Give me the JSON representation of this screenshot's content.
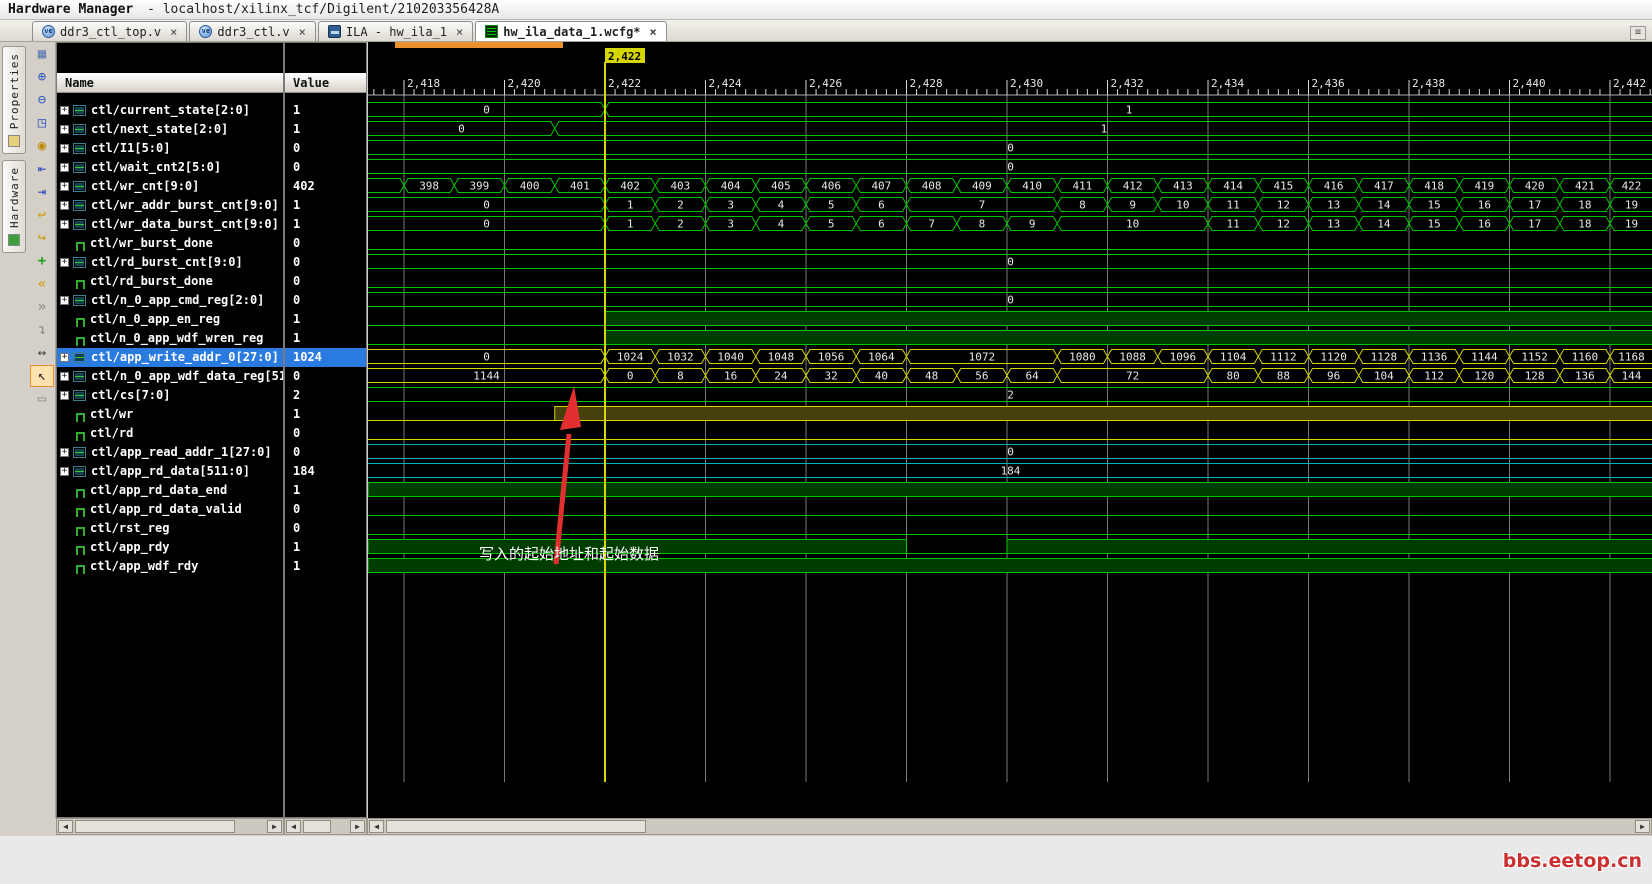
{
  "title_bar": {
    "app_name": "Hardware Manager",
    "session": "- localhost/xilinx_tcf/Digilent/210203356428A"
  },
  "tabs": [
    {
      "label": "ddr3_ctl_top.v",
      "icon": "verilog-file-icon",
      "close": "×",
      "active": false
    },
    {
      "label": "ddr3_ctl.v",
      "icon": "verilog-file-icon",
      "close": "×",
      "active": false
    },
    {
      "label": "ILA - hw_ila_1",
      "icon": "ila-icon",
      "close": "×",
      "active": false
    },
    {
      "label": "hw_ila_data_1.wcfg*",
      "icon": "waveform-icon",
      "close": "×",
      "active": true
    }
  ],
  "side_tabs": [
    {
      "label": "Properties",
      "icon": "properties-icon"
    },
    {
      "label": "Hardware",
      "icon": "hardware-icon"
    }
  ],
  "toolbar_icons": [
    {
      "name": "save-waveform-icon",
      "active": false
    },
    {
      "name": "zoom-in-icon",
      "active": false
    },
    {
      "name": "zoom-out-icon",
      "active": false
    },
    {
      "name": "zoom-fit-icon",
      "active": false
    },
    {
      "name": "zoom-range-icon",
      "active": false
    },
    {
      "name": "go-to-start-icon",
      "active": false
    },
    {
      "name": "go-to-end-icon",
      "active": false
    },
    {
      "name": "previous-transition-icon",
      "active": false
    },
    {
      "name": "next-transition-icon",
      "active": false
    },
    {
      "name": "add-signal-icon",
      "active": false
    },
    {
      "name": "insert-before-icon",
      "active": false
    },
    {
      "name": "insert-after-icon",
      "active": false
    },
    {
      "name": "collapse-icon",
      "active": false
    },
    {
      "name": "measure-icon",
      "active": false
    },
    {
      "name": "select-pointer-icon",
      "active": true
    },
    {
      "name": "snap-mode-icon",
      "active": false
    }
  ],
  "table": {
    "name_header": "Name",
    "value_header": "Value"
  },
  "waveform": {
    "axis": {
      "tick_labels": [
        "2,418",
        "2,420",
        "2,422",
        "2,424",
        "2,426",
        "2,428",
        "2,430",
        "2,432",
        "2,434",
        "2,436",
        "2,438",
        "2,440",
        "2,442"
      ],
      "t_start": 2418,
      "t_step": 2,
      "minor_per_major": 10
    },
    "cursor": {
      "time": 2422,
      "label": "2,422"
    },
    "annotation": {
      "text": "写入的起始地址和起始数据"
    },
    "colors": {
      "wave_green": "#00c400",
      "wave_yellow": "#d4d400",
      "wave_cyan": "#00b4b4",
      "fill_green": "#003c00",
      "fill_yellow": "#45400a",
      "fill_cyan": "#003c3c",
      "cursor": "#d6d600",
      "grid": "#787878",
      "annotation": "#e23030",
      "selection": "#2a7be0",
      "active_tab_bar": "#e8912d"
    },
    "signals": [
      {
        "name": "ctl/current_state[2:0]",
        "value": "1",
        "kind": "bus",
        "color": "green",
        "selected": false,
        "segs": [
          [
            "0",
            2417,
            2422
          ],
          [
            "1",
            2422,
            2443
          ]
        ]
      },
      {
        "name": "ctl/next_state[2:0]",
        "value": "1",
        "kind": "bus",
        "color": "green",
        "selected": false,
        "segs": [
          [
            "0",
            2417,
            2421
          ],
          [
            "1",
            2421,
            2443
          ]
        ]
      },
      {
        "name": "ctl/I1[5:0]",
        "value": "0",
        "kind": "bus",
        "color": "green",
        "selected": false,
        "segs": [
          [
            "0",
            2417,
            2443
          ]
        ]
      },
      {
        "name": "ctl/wait_cnt2[5:0]",
        "value": "0",
        "kind": "bus",
        "color": "green",
        "selected": false,
        "segs": [
          [
            "0",
            2417,
            2443
          ]
        ]
      },
      {
        "name": "ctl/wr_cnt[9:0]",
        "value": "402",
        "kind": "bus",
        "color": "green",
        "selected": false,
        "segs": [
          [
            "",
            2417,
            2418
          ],
          [
            "398",
            2418,
            2419
          ],
          [
            "399",
            2419,
            2420
          ],
          [
            "400",
            2420,
            2421
          ],
          [
            "401",
            2421,
            2422
          ],
          [
            "402",
            2422,
            2423
          ],
          [
            "403",
            2423,
            2424
          ],
          [
            "404",
            2424,
            2425
          ],
          [
            "405",
            2425,
            2426
          ],
          [
            "406",
            2426,
            2427
          ],
          [
            "407",
            2427,
            2428
          ],
          [
            "408",
            2428,
            2429
          ],
          [
            "409",
            2429,
            2430
          ],
          [
            "410",
            2430,
            2431
          ],
          [
            "411",
            2431,
            2432
          ],
          [
            "412",
            2432,
            2433
          ],
          [
            "413",
            2433,
            2434
          ],
          [
            "414",
            2434,
            2435
          ],
          [
            "415",
            2435,
            2436
          ],
          [
            "416",
            2436,
            2437
          ],
          [
            "417",
            2437,
            2438
          ],
          [
            "418",
            2438,
            2439
          ],
          [
            "419",
            2439,
            2440
          ],
          [
            "420",
            2440,
            2441
          ],
          [
            "421",
            2441,
            2442
          ],
          [
            "422",
            2442,
            2443
          ]
        ]
      },
      {
        "name": "ctl/wr_addr_burst_cnt[9:0]",
        "value": "1",
        "kind": "bus",
        "color": "green",
        "selected": false,
        "segs": [
          [
            "0",
            2417,
            2422
          ],
          [
            "1",
            2422,
            2423
          ],
          [
            "2",
            2423,
            2424
          ],
          [
            "3",
            2424,
            2425
          ],
          [
            "4",
            2425,
            2426
          ],
          [
            "5",
            2426,
            2427
          ],
          [
            "6",
            2427,
            2428
          ],
          [
            "7",
            2428,
            2431
          ],
          [
            "8",
            2431,
            2432
          ],
          [
            "9",
            2432,
            2433
          ],
          [
            "10",
            2433,
            2434
          ],
          [
            "11",
            2434,
            2435
          ],
          [
            "12",
            2435,
            2436
          ],
          [
            "13",
            2436,
            2437
          ],
          [
            "14",
            2437,
            2438
          ],
          [
            "15",
            2438,
            2439
          ],
          [
            "16",
            2439,
            2440
          ],
          [
            "17",
            2440,
            2441
          ],
          [
            "18",
            2441,
            2442
          ],
          [
            "19",
            2442,
            2443
          ]
        ]
      },
      {
        "name": "ctl/wr_data_burst_cnt[9:0]",
        "value": "1",
        "kind": "bus",
        "color": "green",
        "selected": false,
        "segs": [
          [
            "0",
            2417,
            2422
          ],
          [
            "1",
            2422,
            2423
          ],
          [
            "2",
            2423,
            2424
          ],
          [
            "3",
            2424,
            2425
          ],
          [
            "4",
            2425,
            2426
          ],
          [
            "5",
            2426,
            2427
          ],
          [
            "6",
            2427,
            2428
          ],
          [
            "7",
            2428,
            2429
          ],
          [
            "8",
            2429,
            2430
          ],
          [
            "9",
            2430,
            2431
          ],
          [
            "10",
            2431,
            2434
          ],
          [
            "11",
            2434,
            2435
          ],
          [
            "12",
            2435,
            2436
          ],
          [
            "13",
            2436,
            2437
          ],
          [
            "14",
            2437,
            2438
          ],
          [
            "15",
            2438,
            2439
          ],
          [
            "16",
            2439,
            2440
          ],
          [
            "17",
            2440,
            2441
          ],
          [
            "18",
            2441,
            2442
          ],
          [
            "19",
            2442,
            2443
          ]
        ]
      },
      {
        "name": "ctl/wr_burst_done",
        "value": "0",
        "kind": "bit",
        "color": "green",
        "selected": false,
        "segs": [
          [
            0,
            2417,
            2443
          ]
        ]
      },
      {
        "name": "ctl/rd_burst_cnt[9:0]",
        "value": "0",
        "kind": "bus",
        "color": "green",
        "selected": false,
        "segs": [
          [
            "0",
            2417,
            2443
          ]
        ]
      },
      {
        "name": "ctl/rd_burst_done",
        "value": "0",
        "kind": "bit",
        "color": "green",
        "selected": false,
        "segs": [
          [
            0,
            2417,
            2443
          ]
        ]
      },
      {
        "name": "ctl/n_0_app_cmd_reg[2:0]",
        "value": "0",
        "kind": "bus",
        "color": "green",
        "selected": false,
        "segs": [
          [
            "0",
            2417,
            2443
          ]
        ]
      },
      {
        "name": "ctl/n_0_app_en_reg",
        "value": "1",
        "kind": "bit",
        "color": "green",
        "selected": false,
        "segs": [
          [
            0,
            2417,
            2422
          ],
          [
            1,
            2422,
            2443
          ]
        ]
      },
      {
        "name": "ctl/n_0_app_wdf_wren_reg",
        "value": "1",
        "kind": "bit",
        "color": "green",
        "selected": false,
        "segs": [
          [
            0,
            2417,
            2422
          ],
          [
            1,
            2422,
            2443
          ]
        ]
      },
      {
        "name": "ctl/app_write_addr_0[27:0]",
        "value": "1024",
        "kind": "bus",
        "color": "yellow",
        "selected": true,
        "segs": [
          [
            "0",
            2417,
            2422
          ],
          [
            "1024",
            2422,
            2423
          ],
          [
            "1032",
            2423,
            2424
          ],
          [
            "1040",
            2424,
            2425
          ],
          [
            "1048",
            2425,
            2426
          ],
          [
            "1056",
            2426,
            2427
          ],
          [
            "1064",
            2427,
            2428
          ],
          [
            "1072",
            2428,
            2431
          ],
          [
            "1080",
            2431,
            2432
          ],
          [
            "1088",
            2432,
            2433
          ],
          [
            "1096",
            2433,
            2434
          ],
          [
            "1104",
            2434,
            2435
          ],
          [
            "1112",
            2435,
            2436
          ],
          [
            "1120",
            2436,
            2437
          ],
          [
            "1128",
            2437,
            2438
          ],
          [
            "1136",
            2438,
            2439
          ],
          [
            "1144",
            2439,
            2440
          ],
          [
            "1152",
            2440,
            2441
          ],
          [
            "1160",
            2441,
            2442
          ],
          [
            "1168",
            2442,
            2443
          ]
        ]
      },
      {
        "name": "ctl/n_0_app_wdf_data_reg[511:0]",
        "value": "0",
        "kind": "bus",
        "color": "yellow",
        "selected": false,
        "segs": [
          [
            "1144",
            2417,
            2422
          ],
          [
            "0",
            2422,
            2423
          ],
          [
            "8",
            2423,
            2424
          ],
          [
            "16",
            2424,
            2425
          ],
          [
            "24",
            2425,
            2426
          ],
          [
            "32",
            2426,
            2427
          ],
          [
            "40",
            2427,
            2428
          ],
          [
            "48",
            2428,
            2429
          ],
          [
            "56",
            2429,
            2430
          ],
          [
            "64",
            2430,
            2431
          ],
          [
            "72",
            2431,
            2434
          ],
          [
            "80",
            2434,
            2435
          ],
          [
            "88",
            2435,
            2436
          ],
          [
            "96",
            2436,
            2437
          ],
          [
            "104",
            2437,
            2438
          ],
          [
            "112",
            2438,
            2439
          ],
          [
            "120",
            2439,
            2440
          ],
          [
            "128",
            2440,
            2441
          ],
          [
            "136",
            2441,
            2442
          ],
          [
            "144",
            2442,
            2443
          ]
        ]
      },
      {
        "name": "ctl/cs[7:0]",
        "value": "2",
        "kind": "bus",
        "color": "green",
        "selected": false,
        "segs": [
          [
            "2",
            2417,
            2443
          ]
        ]
      },
      {
        "name": "ctl/wr",
        "value": "1",
        "kind": "bit",
        "color": "yellow",
        "selected": false,
        "segs": [
          [
            0,
            2417,
            2421
          ],
          [
            1,
            2421,
            2443
          ]
        ]
      },
      {
        "name": "ctl/rd",
        "value": "0",
        "kind": "bit",
        "color": "yellow",
        "selected": false,
        "segs": [
          [
            0,
            2417,
            2443
          ]
        ]
      },
      {
        "name": "ctl/app_read_addr_1[27:0]",
        "value": "0",
        "kind": "bus",
        "color": "cyan",
        "selected": false,
        "segs": [
          [
            "0",
            2417,
            2443
          ]
        ]
      },
      {
        "name": "ctl/app_rd_data[511:0]",
        "value": "184",
        "kind": "bus",
        "color": "cyan",
        "selected": false,
        "segs": [
          [
            "184",
            2417,
            2443
          ]
        ]
      },
      {
        "name": "ctl/app_rd_data_end",
        "value": "1",
        "kind": "bit",
        "color": "green",
        "selected": false,
        "segs": [
          [
            1,
            2417,
            2443
          ]
        ]
      },
      {
        "name": "ctl/app_rd_data_valid",
        "value": "0",
        "kind": "bit",
        "color": "green",
        "selected": false,
        "segs": [
          [
            0,
            2417,
            2443
          ]
        ]
      },
      {
        "name": "ctl/rst_reg",
        "value": "0",
        "kind": "bit",
        "color": "green",
        "selected": false,
        "segs": [
          [
            0,
            2417,
            2443
          ]
        ]
      },
      {
        "name": "ctl/app_rdy",
        "value": "1",
        "kind": "bit",
        "color": "green",
        "selected": false,
        "segs": [
          [
            1,
            2417,
            2428
          ],
          [
            0,
            2428,
            2430
          ],
          [
            1,
            2430,
            2443
          ]
        ]
      },
      {
        "name": "ctl/app_wdf_rdy",
        "value": "1",
        "kind": "bit",
        "color": "green",
        "selected": false,
        "segs": [
          [
            1,
            2417,
            2443
          ]
        ]
      }
    ]
  },
  "watermark": "bbs.eetop.cn"
}
